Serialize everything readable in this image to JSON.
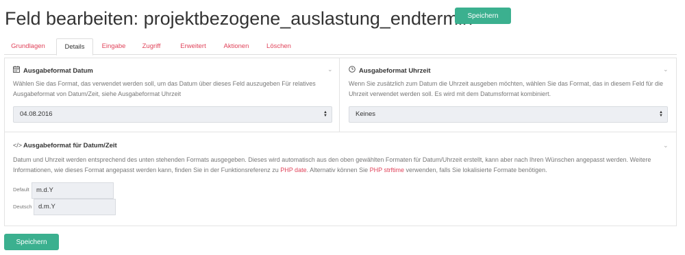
{
  "header": {
    "title": "Feld bearbeiten: projektbezogene_auslastung_endtermin",
    "save_label": "Speichern"
  },
  "tabs": [
    {
      "label": "Grundlagen",
      "active": false
    },
    {
      "label": "Details",
      "active": true
    },
    {
      "label": "Eingabe",
      "active": false
    },
    {
      "label": "Zugriff",
      "active": false
    },
    {
      "label": "Erweitert",
      "active": false
    },
    {
      "label": "Aktionen",
      "active": false
    },
    {
      "label": "Löschen",
      "active": false
    }
  ],
  "date_format": {
    "icon": "calendar-icon",
    "heading": "Ausgabeformat Datum",
    "description": "Wählen Sie das Format, das verwendet werden soll, um das Datum über dieses Feld auszugeben Für relatives Ausgabeformat von Datum/Zeit, siehe Ausgabeformat Uhrzeit",
    "selected": "04.08.2016"
  },
  "time_format": {
    "icon": "clock-icon",
    "heading": "Ausgabeformat Uhrzeit",
    "description": "Wenn Sie zusätzlich zum Datum die Uhrzeit ausgeben möchten, wählen Sie das Format, das in diesem Feld für die Uhrzeit verwendet werden soll. Es wird mit dem Datumsformat kombiniert.",
    "selected": "Keines"
  },
  "datetime_format": {
    "icon": "code-icon",
    "heading": "Ausgabeformat für Datum/Zeit",
    "desc_1": "Datum und Uhrzeit werden entsprechend des unten stehenden Formats ausgegeben. Dieses wird automatisch aus den oben gewählten Formaten für Datum/Uhrzeit erstellt, kann aber nach Ihren Wünschen angepasst werden. Weitere Informationen, wie dieses Format angepasst werden kann, finden Sie in der Funktionsreferenz zu ",
    "link_php_date": "PHP date",
    "desc_2": ". Alternativ können Sie ",
    "link_php_strftime": "PHP strftime",
    "desc_3": " verwenden, falls Sie lokalisierte Formate benötigen.",
    "fields": [
      {
        "label": "Default",
        "value": "m.d.Y"
      },
      {
        "label": "Deutsch",
        "value": "d.m.Y"
      }
    ]
  },
  "footer": {
    "save_label": "Speichern"
  },
  "colors": {
    "accent": "#3bb08f",
    "link": "#e0435a"
  }
}
